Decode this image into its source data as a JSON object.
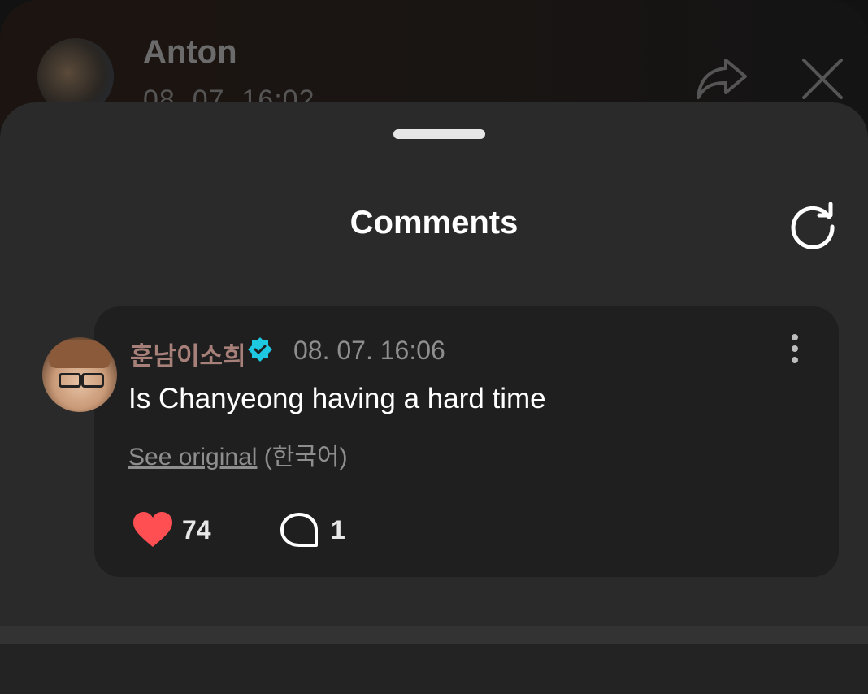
{
  "background_post": {
    "author": "Anton",
    "timestamp": "08. 07. 16:02"
  },
  "sheet": {
    "title": "Comments"
  },
  "comment": {
    "author": "훈남이소희",
    "timestamp": "08. 07. 16:06",
    "text": "Is Chanyeong having a hard time",
    "translate_link": "See original",
    "translate_lang": " (한국어)",
    "likes": "74",
    "replies": "1"
  },
  "colors": {
    "sheet_bg": "#2a2a2a",
    "card_bg": "#1f1f1f",
    "heart": "#ff4f52",
    "verified": "#1ec8e0",
    "author_name": "#a8807a"
  },
  "icons": [
    "share-icon",
    "close-icon",
    "refresh-icon",
    "verified-badge-icon",
    "more-vertical-icon",
    "heart-icon",
    "reply-bubble-icon"
  ]
}
